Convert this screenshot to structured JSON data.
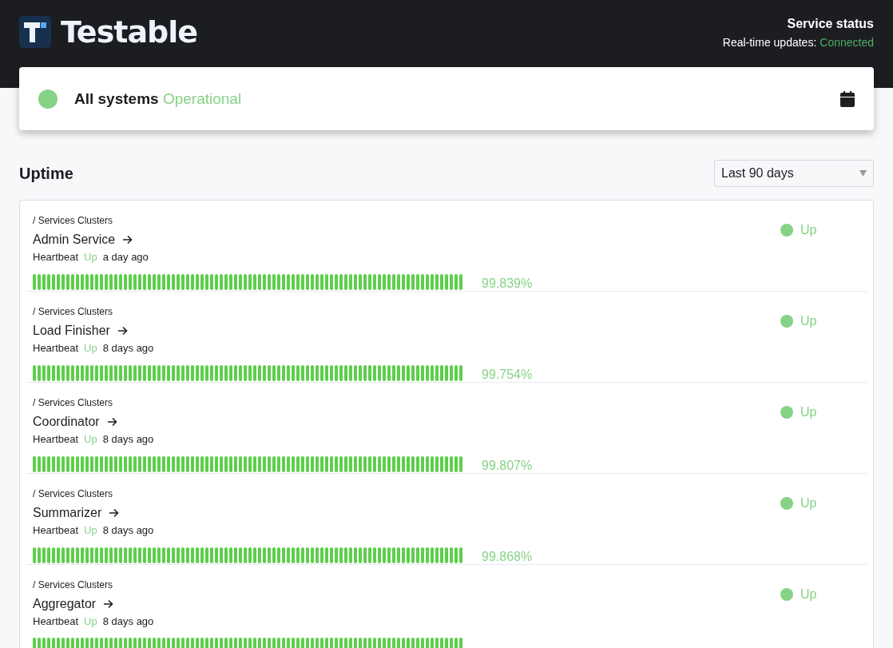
{
  "header": {
    "brand": "Testable",
    "title": "Service status",
    "realtime_label": "Real-time updates:",
    "realtime_status": {
      "label": "Connected",
      "kind": "connected"
    }
  },
  "summary": {
    "prefix": "All systems",
    "status": {
      "label": "Operational",
      "kind": "operational"
    }
  },
  "uptime": {
    "title": "Uptime",
    "range": {
      "value": "Last 90 days"
    },
    "services": [
      {
        "group": "/ Services Clusters",
        "name": "Admin Service",
        "heartbeat_label": "Heartbeat",
        "heartbeat": {
          "label": "Up",
          "kind": "up"
        },
        "last_seen": "a day ago",
        "uptime": "99.839%",
        "status": {
          "label": "Up",
          "kind": "up"
        }
      },
      {
        "group": "/ Services Clusters",
        "name": "Load Finisher",
        "heartbeat_label": "Heartbeat",
        "heartbeat": {
          "label": "Up",
          "kind": "up"
        },
        "last_seen": "8 days ago",
        "uptime": "99.754%",
        "status": {
          "label": "Up",
          "kind": "up"
        }
      },
      {
        "group": "/ Services Clusters",
        "name": "Coordinator",
        "heartbeat_label": "Heartbeat",
        "heartbeat": {
          "label": "Up",
          "kind": "up"
        },
        "last_seen": "8 days ago",
        "uptime": "99.807%",
        "status": {
          "label": "Up",
          "kind": "up"
        }
      },
      {
        "group": "/ Services Clusters",
        "name": "Summarizer",
        "heartbeat_label": "Heartbeat",
        "heartbeat": {
          "label": "Up",
          "kind": "up"
        },
        "last_seen": "8 days ago",
        "uptime": "99.868%",
        "status": {
          "label": "Up",
          "kind": "up"
        }
      },
      {
        "group": "/ Services Clusters",
        "name": "Aggregator",
        "heartbeat_label": "Heartbeat",
        "heartbeat": {
          "label": "Up",
          "kind": "up"
        },
        "last_seen": "8 days ago",
        "status": {
          "label": "Up",
          "kind": "up"
        }
      }
    ]
  }
}
